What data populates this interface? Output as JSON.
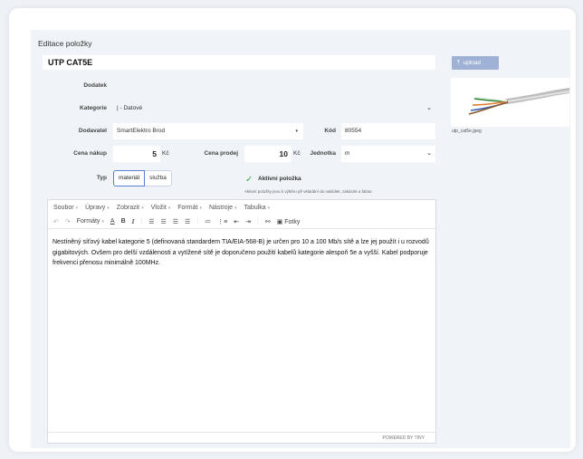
{
  "page": {
    "title": "Editace položky"
  },
  "item": {
    "name": "UTP CAT5E"
  },
  "fields": {
    "dodatek": {
      "label": "Dodatek",
      "value": ""
    },
    "kategorie": {
      "label": "Kategorie",
      "value": "| - Datové"
    },
    "dodavatel": {
      "label": "Dodavatel",
      "value": "SmartElektro Brod"
    },
    "kod": {
      "label": "Kód",
      "value": "80554"
    },
    "cena_nakup": {
      "label": "Cena nákup",
      "value": "5",
      "unit": "Kč"
    },
    "cena_prodej": {
      "label": "Cena prodej",
      "value": "10",
      "unit": "Kč"
    },
    "jednotka": {
      "label": "Jednotka",
      "value": "m"
    },
    "typ": {
      "label": "Typ",
      "options": [
        "materiál",
        "služba"
      ],
      "selected": "materiál"
    }
  },
  "active": {
    "label": "Aktivní položka",
    "hint": "Aktivní položky jsou k výběru při vkládání do nabídek, zakázek a faktur.",
    "checked": true
  },
  "editor": {
    "menu": [
      "Soubor",
      "Úpravy",
      "Zobrazit",
      "Vložit",
      "Formát",
      "Nástroje",
      "Tabulka"
    ],
    "toolbar": {
      "formats": "Formáty",
      "bold": "B",
      "italic": "I",
      "underline": "A",
      "photos": "Fotky"
    },
    "content": "Nestíněný síťový kabel kategorie 5 (definovaná standardem TIA/EIA-568-B) je určen pro 10 a 100 Mb/s sítě a lze jej použít i u rozvodů gigabitových. Ovšem pro delší vzdálenosti a vytížené sítě je doporučeno použití kabelů kategorie alespoň 5e a vyšší. Kabel podporuje frekvenci přenosu minimálně 100MHz.",
    "powered": "POWERED BY TINY"
  },
  "upload": {
    "label": "upload",
    "filename": "utp_cat5e.jpeg"
  },
  "icons": {
    "upload": "upload-icon",
    "check": "check-icon",
    "chevron": "chevron-down-icon"
  }
}
